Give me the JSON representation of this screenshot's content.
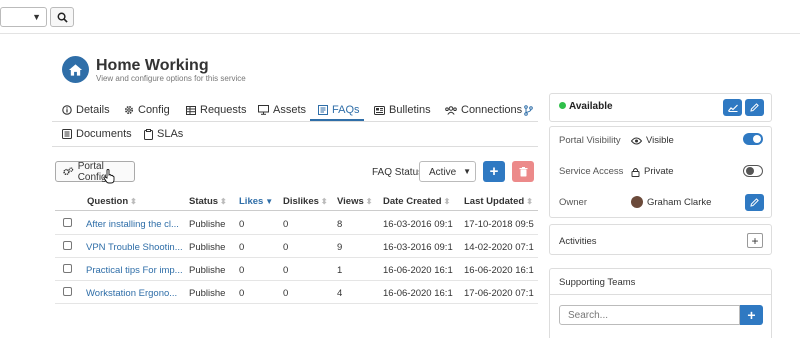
{
  "service": {
    "title": "Home Working",
    "subtitle": "View and configure options for this service"
  },
  "tabs": [
    {
      "label": "Details",
      "icon": "info-circle-icon"
    },
    {
      "label": "Config",
      "icon": "gear-icon"
    },
    {
      "label": "Requests",
      "icon": "table-icon"
    },
    {
      "label": "Assets",
      "icon": "monitor-icon"
    },
    {
      "label": "FAQs",
      "icon": "faq-icon",
      "active": true
    },
    {
      "label": "Bulletins",
      "icon": "newspaper-icon"
    },
    {
      "label": "Connections",
      "icon": "users-icon"
    },
    {
      "label": "Documents",
      "icon": "document-icon"
    },
    {
      "label": "SLAs",
      "icon": "clipboard-icon"
    }
  ],
  "toolbar": {
    "portal_config_label": "Portal Config",
    "faq_status_label": "FAQ Status:",
    "faq_status_value": "Active"
  },
  "table": {
    "headers": [
      "Question",
      "Status",
      "Likes",
      "Dislikes",
      "Views",
      "Date Created",
      "Last Updated"
    ],
    "sorted_column": "Likes",
    "rows": [
      {
        "question": "After installing the cl...",
        "status": "Publishe",
        "likes": "0",
        "dislikes": "0",
        "views": "8",
        "created": "16-03-2016 09:1",
        "updated": "17-10-2018 09:5"
      },
      {
        "question": "VPN Trouble Shootin...",
        "status": "Publishe",
        "likes": "0",
        "dislikes": "0",
        "views": "9",
        "created": "16-03-2016 09:1",
        "updated": "14-02-2020 07:1"
      },
      {
        "question": "Practical tips For imp...",
        "status": "Publishe",
        "likes": "0",
        "dislikes": "0",
        "views": "1",
        "created": "16-06-2020 16:1",
        "updated": "16-06-2020 16:1"
      },
      {
        "question": "Workstation Ergono...",
        "status": "Publishe",
        "likes": "0",
        "dislikes": "0",
        "views": "4",
        "created": "16-06-2020 16:1",
        "updated": "17-06-2020 07:1"
      }
    ]
  },
  "status_panel": {
    "availability": "Available",
    "available_color": "#2fbf4a"
  },
  "properties": {
    "portal_visibility": {
      "label": "Portal Visibility",
      "value": "Visible",
      "toggle_on": true
    },
    "service_access": {
      "label": "Service Access",
      "value": "Private",
      "toggle_on": false
    },
    "owner": {
      "label": "Owner",
      "value": "Graham Clarke"
    }
  },
  "activities": {
    "title": "Activities"
  },
  "supporting_teams": {
    "title": "Supporting Teams",
    "search_placeholder": "Search..."
  },
  "colors": {
    "primary": "#2f79c2",
    "danger_light": "#ec8a8a",
    "link": "#2f6ea8"
  }
}
